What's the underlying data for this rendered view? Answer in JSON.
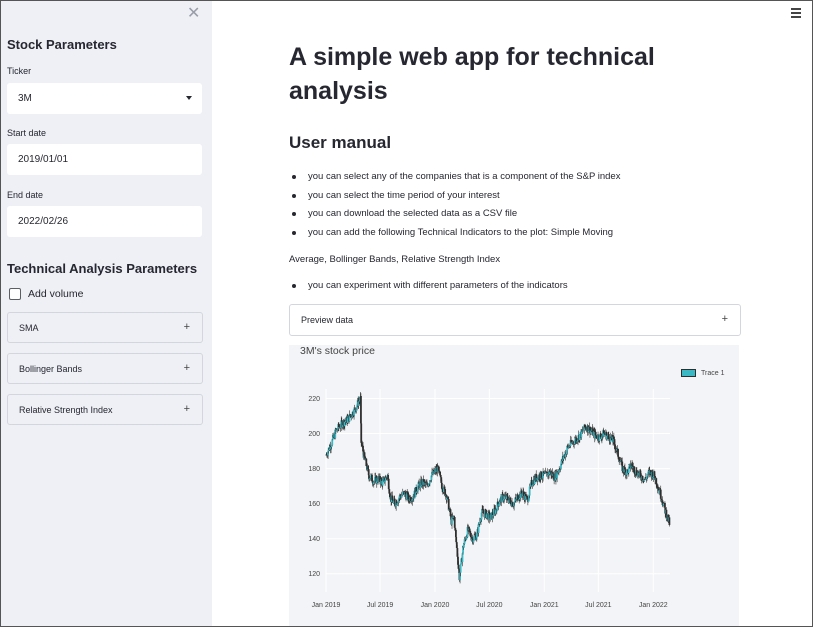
{
  "sidebar": {
    "close_icon": "✕",
    "section1_title": "Stock Parameters",
    "ticker_label": "Ticker",
    "ticker_value": "3M",
    "start_label": "Start date",
    "start_value": "2019/01/01",
    "end_label": "End date",
    "end_value": "2022/02/26",
    "section2_title": "Technical Analysis Parameters",
    "volume_label": "Add volume",
    "volume_checked": false,
    "expanders": [
      {
        "label": "SMA"
      },
      {
        "label": "Bollinger Bands"
      },
      {
        "label": "Relative Strength Index"
      }
    ]
  },
  "main": {
    "title": "A simple web app for technical analysis",
    "manual_title": "User manual",
    "bullets": [
      "you can select any of the companies that is a component of the S&P index",
      "you can select the time period of your interest",
      "you can download the selected data as a CSV file",
      "you can add the following Technical Indicators to the plot: Simple Moving"
    ],
    "paragraph": "Average, Bollinger Bands, Relative Strength Index",
    "bullets2": [
      "you can experiment with different parameters of the indicators"
    ],
    "preview_label": "Preview data",
    "plus_glyph": "+"
  },
  "chart_data": {
    "type": "candlestick",
    "title": "3M's stock price",
    "legend": [
      "Trace 1"
    ],
    "legend_position": "top-right",
    "up_color": "#3ab8c4",
    "down_color": "#2e2e2e",
    "x_ticks": [
      "Jan 2019",
      "Jul 2019",
      "Jan 2020",
      "Jul 2020",
      "Jan 2021",
      "Jul 2021",
      "Jan 2022"
    ],
    "y_ticks": [
      120,
      140,
      160,
      180,
      200,
      220
    ],
    "ylim": [
      113,
      222
    ],
    "xlim": [
      "2019-01-01",
      "2022-02-26"
    ],
    "grid": true,
    "close_series": [
      [
        "2019-01-02",
        188
      ],
      [
        "2019-01-20",
        195
      ],
      [
        "2019-02-05",
        202
      ],
      [
        "2019-02-25",
        206
      ],
      [
        "2019-03-15",
        208
      ],
      [
        "2019-04-05",
        213
      ],
      [
        "2019-04-20",
        218
      ],
      [
        "2019-04-26",
        220
      ],
      [
        "2019-04-29",
        195
      ],
      [
        "2019-05-10",
        186
      ],
      [
        "2019-05-25",
        176
      ],
      [
        "2019-06-10",
        173
      ],
      [
        "2019-06-25",
        174
      ],
      [
        "2019-07-10",
        172
      ],
      [
        "2019-07-26",
        176
      ],
      [
        "2019-08-05",
        163
      ],
      [
        "2019-08-20",
        160
      ],
      [
        "2019-09-05",
        164
      ],
      [
        "2019-09-20",
        166
      ],
      [
        "2019-10-05",
        163
      ],
      [
        "2019-10-20",
        164
      ],
      [
        "2019-11-05",
        170
      ],
      [
        "2019-11-20",
        172
      ],
      [
        "2019-12-05",
        170
      ],
      [
        "2019-12-20",
        176
      ],
      [
        "2020-01-10",
        180
      ],
      [
        "2020-01-25",
        170
      ],
      [
        "2020-02-10",
        164
      ],
      [
        "2020-02-25",
        150
      ],
      [
        "2020-03-05",
        152
      ],
      [
        "2020-03-12",
        138
      ],
      [
        "2020-03-23",
        118
      ],
      [
        "2020-04-05",
        136
      ],
      [
        "2020-04-20",
        145
      ],
      [
        "2020-05-05",
        140
      ],
      [
        "2020-05-20",
        142
      ],
      [
        "2020-06-05",
        155
      ],
      [
        "2020-06-20",
        154
      ],
      [
        "2020-07-05",
        152
      ],
      [
        "2020-07-20",
        156
      ],
      [
        "2020-08-05",
        162
      ],
      [
        "2020-08-20",
        164
      ],
      [
        "2020-09-05",
        162
      ],
      [
        "2020-09-20",
        160
      ],
      [
        "2020-10-05",
        164
      ],
      [
        "2020-10-20",
        166
      ],
      [
        "2020-11-05",
        162
      ],
      [
        "2020-11-20",
        172
      ],
      [
        "2020-12-05",
        175
      ],
      [
        "2020-12-20",
        176
      ],
      [
        "2021-01-05",
        176
      ],
      [
        "2021-01-20",
        178
      ],
      [
        "2021-02-05",
        175
      ],
      [
        "2021-02-20",
        180
      ],
      [
        "2021-03-05",
        186
      ],
      [
        "2021-03-20",
        192
      ],
      [
        "2021-04-05",
        195
      ],
      [
        "2021-04-20",
        197
      ],
      [
        "2021-05-05",
        200
      ],
      [
        "2021-05-20",
        204
      ],
      [
        "2021-06-05",
        202
      ],
      [
        "2021-06-20",
        199
      ],
      [
        "2021-07-05",
        198
      ],
      [
        "2021-07-20",
        200
      ],
      [
        "2021-08-05",
        198
      ],
      [
        "2021-08-20",
        196
      ],
      [
        "2021-09-05",
        188
      ],
      [
        "2021-09-20",
        180
      ],
      [
        "2021-10-05",
        178
      ],
      [
        "2021-10-20",
        182
      ],
      [
        "2021-11-05",
        178
      ],
      [
        "2021-11-20",
        176
      ],
      [
        "2021-12-05",
        174
      ],
      [
        "2021-12-20",
        178
      ],
      [
        "2022-01-05",
        176
      ],
      [
        "2022-01-20",
        168
      ],
      [
        "2022-02-01",
        162
      ],
      [
        "2022-02-10",
        156
      ],
      [
        "2022-02-18",
        152
      ],
      [
        "2022-02-25",
        148
      ]
    ]
  }
}
